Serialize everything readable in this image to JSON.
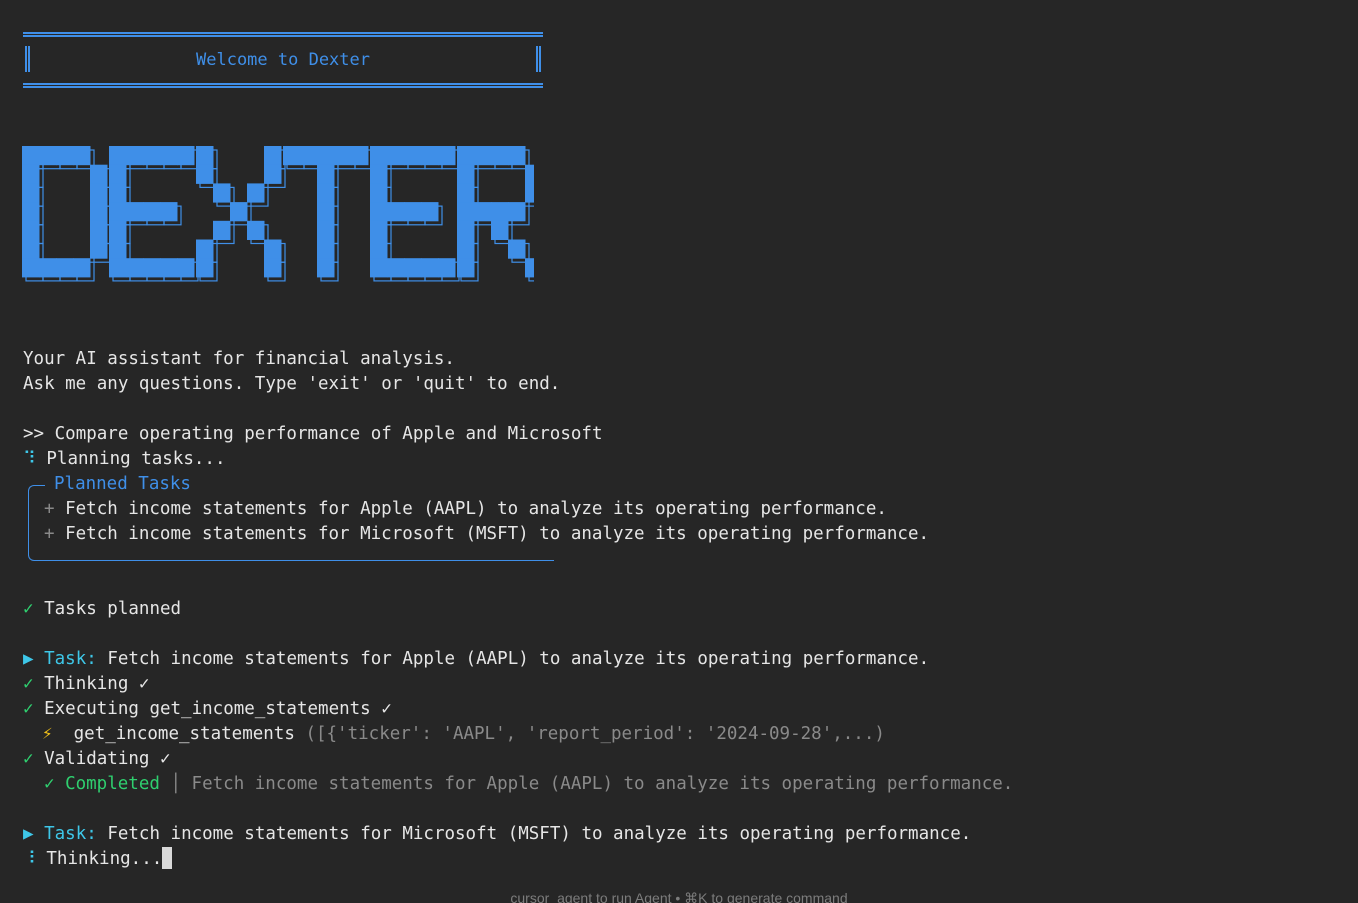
{
  "banner": {
    "welcome": "Welcome to Dexter"
  },
  "logo": {
    "text": "DEXTER",
    "color": "#3f8fe8"
  },
  "intro": {
    "line1": "Your AI assistant for financial analysis.",
    "line2": "Ask me any questions. Type 'exit' or 'quit' to end."
  },
  "prompt": {
    "marker": ">>",
    "query": "Compare operating performance of Apple and Microsoft"
  },
  "planning": {
    "spinner": "⠹",
    "text": "Planning tasks..."
  },
  "planned_tasks": {
    "title": "Planned Tasks",
    "items": [
      {
        "bullet": "+",
        "text": "Fetch income statements for Apple (AAPL) to analyze its operating performance."
      },
      {
        "bullet": "+",
        "text": "Fetch income statements for Microsoft (MSFT) to analyze its operating performance."
      }
    ]
  },
  "tasks_planned": {
    "check": "✓",
    "text": "Tasks planned"
  },
  "task1": {
    "arrow": "▶",
    "label": "Task:",
    "text": "Fetch income statements for Apple (AAPL) to analyze its operating performance.",
    "thinking": "Thinking ✓",
    "executing": "Executing get_income_statements ✓",
    "tool_icon": "⚡",
    "tool_name": "get_income_statements",
    "tool_args": "([{'ticker': 'AAPL', 'report_period': '2024-09-28',...)",
    "validating": "Validating ✓",
    "completed_label": "✓ Completed",
    "separator": "│",
    "completed_text": "Fetch income statements for Apple (AAPL) to analyze its operating performance."
  },
  "task2": {
    "arrow": "▶",
    "label": "Task:",
    "text": "Fetch income statements for Microsoft (MSFT) to analyze its operating performance.",
    "spinner": "⠸",
    "thinking": "Thinking..."
  },
  "check": "✓",
  "footer": {
    "hint": "cursor_agent to run Agent • ⌘K to generate command"
  }
}
